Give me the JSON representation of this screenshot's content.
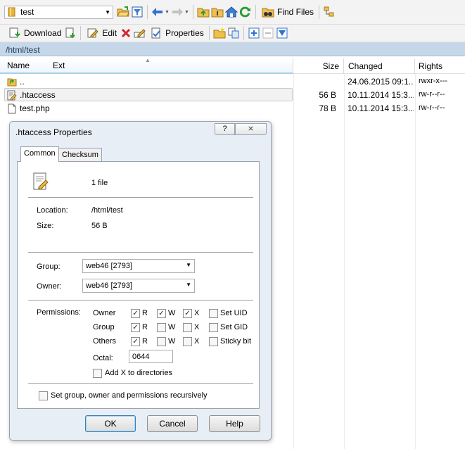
{
  "toolbar1": {
    "location": "test",
    "find_files": "Find Files"
  },
  "toolbar2": {
    "download": "Download",
    "edit": "Edit",
    "properties": "Properties"
  },
  "path": "/html/test",
  "columns": {
    "name": "Name",
    "ext": "Ext",
    "size": "Size",
    "changed": "Changed",
    "rights": "Rights"
  },
  "files": [
    {
      "name": "..",
      "size": "",
      "changed": "24.06.2015 09:1...",
      "rights": "rwxr-x---",
      "icon": "parent-folder-icon"
    },
    {
      "name": ".htaccess",
      "size": "56 B",
      "changed": "10.11.2014 15:3...",
      "rights": "rw-r--r--",
      "icon": "text-file-icon"
    },
    {
      "name": "test.php",
      "size": "78 B",
      "changed": "10.11.2014 15:3...",
      "rights": "rw-r--r--",
      "icon": "file-icon"
    }
  ],
  "dialog": {
    "title": ".htaccess  Properties",
    "help_glyph": "?",
    "close_glyph": "⨯",
    "tabs": [
      "Common",
      "Checksum"
    ],
    "file_count": "1 file",
    "location_label": "Location:",
    "location_value": "/html/test",
    "size_label": "Size:",
    "size_value": "56 B",
    "group_label": "Group:",
    "group_value": "web46 [2793]",
    "owner_label": "Owner:",
    "owner_value": "web46 [2793]",
    "permissions_label": "Permissions:",
    "perm_rows": [
      "Owner",
      "Group",
      "Others"
    ],
    "perm_cols": [
      "R",
      "W",
      "X"
    ],
    "perm_extras": [
      "Set UID",
      "Set GID",
      "Sticky bit"
    ],
    "check_glyph": "✓",
    "octal_label": "Octal:",
    "octal_value": "0644",
    "add_x_label": "Add X to directories",
    "recursive_label": "Set group, owner and permissions recursively",
    "ok": "OK",
    "cancel": "Cancel",
    "help": "Help"
  },
  "permissions": {
    "owner": [
      true,
      true,
      true
    ],
    "group": [
      true,
      false,
      false
    ],
    "others": [
      true,
      false,
      false
    ],
    "set_uid": false,
    "set_gid": false,
    "sticky_bit": false,
    "add_x": false,
    "recursive": false
  },
  "colors": {
    "accent": "#3c7fb1",
    "pathbar": "#c5d7e8",
    "delete": "#d9202a",
    "refresh": "#2f9b34"
  }
}
